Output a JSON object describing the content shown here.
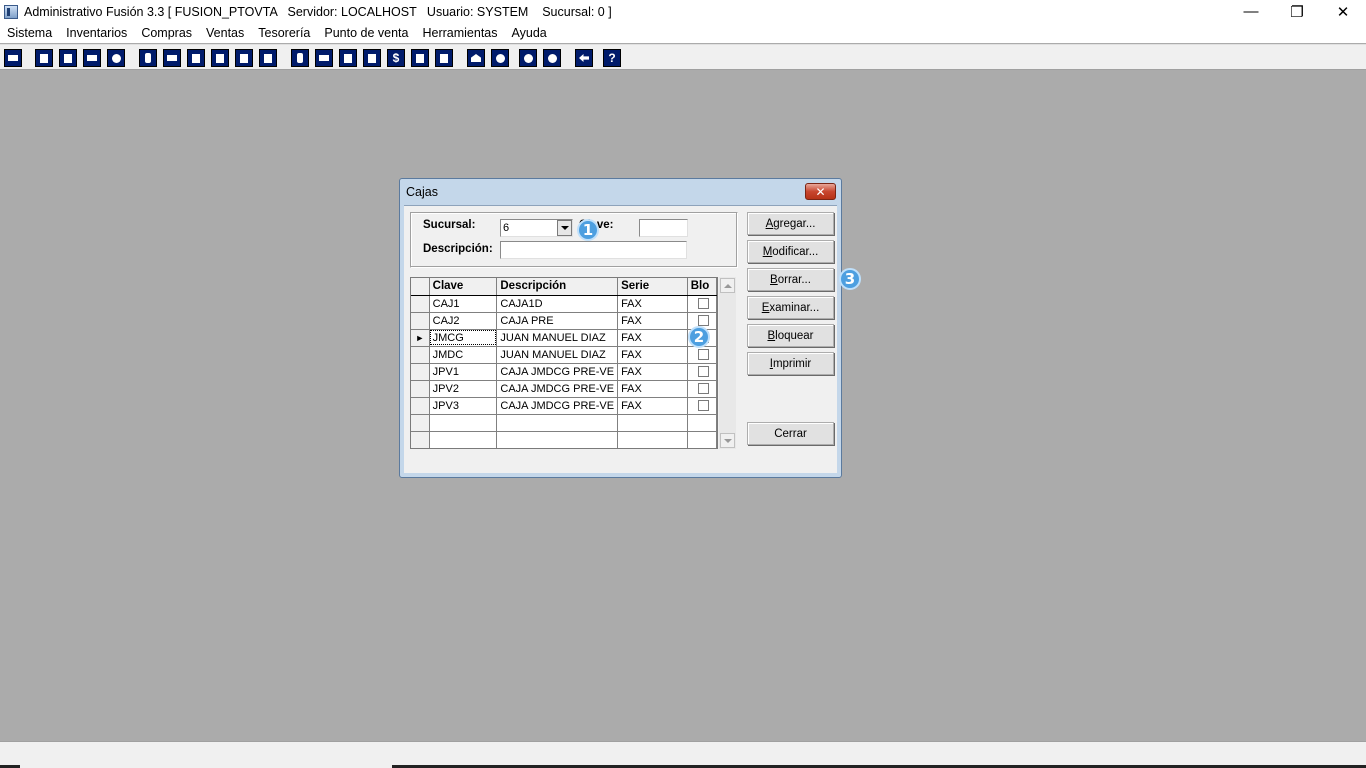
{
  "window": {
    "title": "Administrativo Fusión 3.3 [ FUSION_PTOVTA   Servidor: LOCALHOST   Usuario: SYSTEM    Sucursal: 0 ]",
    "controls": {
      "minimize": "—",
      "restore": "❐",
      "close": "✕"
    }
  },
  "menu": [
    "Sistema",
    "Inventarios",
    "Compras",
    "Ventas",
    "Tesorería",
    "Punto de venta",
    "Herramientas",
    "Ayuda"
  ],
  "toolbar": {
    "dollar": "$",
    "help": "?"
  },
  "dialog": {
    "title": "Cajas",
    "close_label": "✕",
    "sucursal_label": "Sucursal:",
    "sucursal_value": "6",
    "clave_label": "Clave:",
    "clave_value": "",
    "descripcion_label": "Descripción:",
    "descripcion_value": "",
    "grid": {
      "headers": [
        "Clave",
        "Descripción",
        "Serie",
        "Blo"
      ],
      "current_row_marker": "►",
      "rows": [
        {
          "clave": "CAJ1",
          "descripcion": "CAJA1D",
          "serie": "FAX",
          "bloqueada": false
        },
        {
          "clave": "CAJ2",
          "descripcion": "CAJA PRE",
          "serie": "FAX",
          "bloqueada": false
        },
        {
          "clave": "JMCG",
          "descripcion": "JUAN MANUEL DIAZ",
          "serie": "FAX",
          "bloqueada": false
        },
        {
          "clave": "JMDC",
          "descripcion": "JUAN MANUEL DIAZ",
          "serie": "FAX",
          "bloqueada": false
        },
        {
          "clave": "JPV1",
          "descripcion": "CAJA JMDCG PRE-VE",
          "serie": "FAX",
          "bloqueada": false
        },
        {
          "clave": "JPV2",
          "descripcion": "CAJA JMDCG PRE-VE",
          "serie": "FAX",
          "bloqueada": false
        },
        {
          "clave": "JPV3",
          "descripcion": "CAJA JMDCG PRE-VE",
          "serie": "FAX",
          "bloqueada": false
        }
      ]
    },
    "buttons": {
      "agregar": {
        "u": "A",
        "rest": "gregar..."
      },
      "modificar": {
        "u": "M",
        "rest": "odificar..."
      },
      "borrar": {
        "u": "B",
        "rest": "orrar..."
      },
      "examinar": {
        "u": "E",
        "rest": "xaminar..."
      },
      "bloquear": {
        "u": "B",
        "rest": "loquear"
      },
      "imprimir": {
        "u": "I",
        "rest": "mprimir"
      },
      "cerrar": {
        "u": "",
        "rest": "Cerrar"
      }
    },
    "badges": [
      "1",
      "2",
      "3"
    ]
  }
}
